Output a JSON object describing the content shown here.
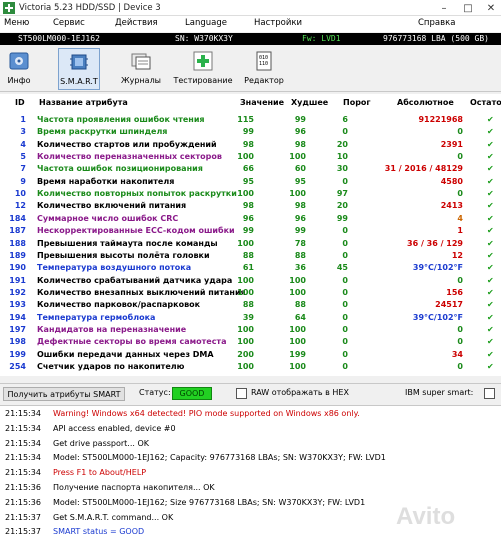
{
  "window": {
    "title": "Victoria 5.23 HDD/SSD | Device 3"
  },
  "menu": [
    "Меню",
    "Сервис",
    "Действия",
    "Language",
    "Настройки",
    "Справка"
  ],
  "device": {
    "model": "ST500LM000-1EJ162",
    "serial": "SN: W370KX3Y",
    "firmware": "Fw: LVD1",
    "lba": "976773168 LBA (500 GB)"
  },
  "toolbar": [
    {
      "label": "Инфо",
      "icon": "drive-info-icon"
    },
    {
      "label": "S.M.A.R.T",
      "icon": "smart-chip-icon",
      "active": true
    },
    {
      "label": "Журналы",
      "icon": "logs-icon"
    },
    {
      "label": "Тестирование",
      "icon": "test-plus-icon"
    },
    {
      "label": "Редактор",
      "icon": "editor-binary-icon"
    }
  ],
  "smart_table": {
    "headers": {
      "id": "ID",
      "name": "Название атрибута",
      "value": "Значение",
      "worst": "Худшее",
      "threshold": "Порог",
      "raw": "Абсолютное",
      "status": "Остато"
    },
    "rows": [
      {
        "id": "1",
        "name": "Частота проявления ошибок чтения",
        "value": "115",
        "worst": "99",
        "threshold": "6",
        "raw": "91221968",
        "color": "#1a8a1a",
        "raw_color": "#cc0000"
      },
      {
        "id": "3",
        "name": "Время раскрутки шпинделя",
        "value": "99",
        "worst": "96",
        "threshold": "0",
        "raw": "0",
        "color": "#1a8a1a",
        "raw_color": "#1a8a1a"
      },
      {
        "id": "4",
        "name": "Количество стартов или пробуждений",
        "value": "98",
        "worst": "98",
        "threshold": "20",
        "raw": "2391",
        "color": "#000000",
        "raw_color": "#cc0000"
      },
      {
        "id": "5",
        "name": "Количество переназначенных секторов",
        "value": "100",
        "worst": "100",
        "threshold": "10",
        "raw": "0",
        "color": "#8a1a8a",
        "raw_color": "#1a8a1a"
      },
      {
        "id": "7",
        "name": "Частота ошибок позиционирования",
        "value": "66",
        "worst": "60",
        "threshold": "30",
        "raw": "31 / 2016 / 48129",
        "color": "#1a8a1a",
        "raw_color": "#cc0000"
      },
      {
        "id": "9",
        "name": "Время наработки накопителя",
        "value": "95",
        "worst": "95",
        "threshold": "0",
        "raw": "4580",
        "color": "#000000",
        "raw_color": "#cc0000"
      },
      {
        "id": "10",
        "name": "Количество повторных попыток раскрутки",
        "value": "100",
        "worst": "100",
        "threshold": "97",
        "raw": "0",
        "color": "#1a8a1a",
        "raw_color": "#1a8a1a"
      },
      {
        "id": "12",
        "name": "Количество включений питания",
        "value": "98",
        "worst": "98",
        "threshold": "20",
        "raw": "2413",
        "color": "#000000",
        "raw_color": "#cc0000"
      },
      {
        "id": "184",
        "name": "Суммарное число ошибок CRC",
        "value": "96",
        "worst": "96",
        "threshold": "99",
        "raw": "4",
        "color": "#8a1a8a",
        "raw_color": "#cc6600"
      },
      {
        "id": "187",
        "name": "Нескорректированные ECC-кодом ошибки",
        "value": "99",
        "worst": "99",
        "threshold": "0",
        "raw": "1",
        "color": "#8a1a8a",
        "raw_color": "#cc0000"
      },
      {
        "id": "188",
        "name": "Превышения таймаута после команды",
        "value": "100",
        "worst": "78",
        "threshold": "0",
        "raw": "36 / 36 / 129",
        "color": "#000000",
        "raw_color": "#cc0000"
      },
      {
        "id": "189",
        "name": "Превышения высоты полёта головки",
        "value": "88",
        "worst": "88",
        "threshold": "0",
        "raw": "12",
        "color": "#000000",
        "raw_color": "#cc0000"
      },
      {
        "id": "190",
        "name": "Температура воздушного потока",
        "value": "61",
        "worst": "36",
        "threshold": "45",
        "raw": "39°C/102°F",
        "color": "#1a3ad0",
        "raw_color": "#1a3ad0"
      },
      {
        "id": "191",
        "name": "Количество срабатываний датчика удара",
        "value": "100",
        "worst": "100",
        "threshold": "0",
        "raw": "0",
        "color": "#000000",
        "raw_color": "#1a8a1a"
      },
      {
        "id": "192",
        "name": "Количество внезапных выключений питания",
        "value": "100",
        "worst": "100",
        "threshold": "0",
        "raw": "156",
        "color": "#000000",
        "raw_color": "#cc0000"
      },
      {
        "id": "193",
        "name": "Количество парковок/распарковок",
        "value": "88",
        "worst": "88",
        "threshold": "0",
        "raw": "24517",
        "color": "#000000",
        "raw_color": "#cc0000"
      },
      {
        "id": "194",
        "name": "Температура гермоблока",
        "value": "39",
        "worst": "64",
        "threshold": "0",
        "raw": "39°C/102°F",
        "color": "#1a3ad0",
        "raw_color": "#1a3ad0"
      },
      {
        "id": "197",
        "name": "Кандидатов на переназначение",
        "value": "100",
        "worst": "100",
        "threshold": "0",
        "raw": "0",
        "color": "#8a1a8a",
        "raw_color": "#1a8a1a"
      },
      {
        "id": "198",
        "name": "Дефектные секторы во время самотеста",
        "value": "100",
        "worst": "100",
        "threshold": "0",
        "raw": "0",
        "color": "#8a1a8a",
        "raw_color": "#1a8a1a"
      },
      {
        "id": "199",
        "name": "Ошибки передачи данных через DMA",
        "value": "200",
        "worst": "199",
        "threshold": "0",
        "raw": "34",
        "color": "#000000",
        "raw_color": "#cc0000"
      },
      {
        "id": "254",
        "name": "Счетчик ударов по накопителю",
        "value": "100",
        "worst": "100",
        "threshold": "0",
        "raw": "0",
        "color": "#000000",
        "raw_color": "#1a8a1a"
      }
    ]
  },
  "bottom": {
    "get_button": "Получить атрибуты SMART",
    "status_label": "Статус:",
    "status_value": "GOOD",
    "raw_hex_label": "RAW отображать в HEX",
    "ibm_label": "IBM super smart:"
  },
  "log": [
    {
      "time": "21:15:34",
      "msg": "Warning! Windows x64 detected! PIO mode supported on Windows x86 only.",
      "color": "#cc0000"
    },
    {
      "time": "21:15:34",
      "msg": "API access enabled, device #0",
      "color": "#000000"
    },
    {
      "time": "21:15:34",
      "msg": "Get drive passport... OK",
      "color": "#000000"
    },
    {
      "time": "21:15:34",
      "msg": "Model: ST500LM000-1EJ162; Capacity: 976773168 LBAs; SN: W370KX3Y; FW: LVD1",
      "color": "#000000"
    },
    {
      "time": "21:15:34",
      "msg": "Press F1 to About/HELP",
      "color": "#cc0000"
    },
    {
      "time": "21:15:36",
      "msg": "Получение паспорта накопителя... OK",
      "color": "#000000"
    },
    {
      "time": "21:15:36",
      "msg": "Model: ST500LM000-1EJ162; Size 976773168 LBAs; SN: W370KX3Y; FW: LVD1",
      "color": "#000000"
    },
    {
      "time": "21:15:37",
      "msg": "Get S.M.A.R.T. command... OK",
      "color": "#000000"
    },
    {
      "time": "21:15:37",
      "msg": "SMART status = GOOD",
      "color": "#1a3ad0"
    }
  ]
}
